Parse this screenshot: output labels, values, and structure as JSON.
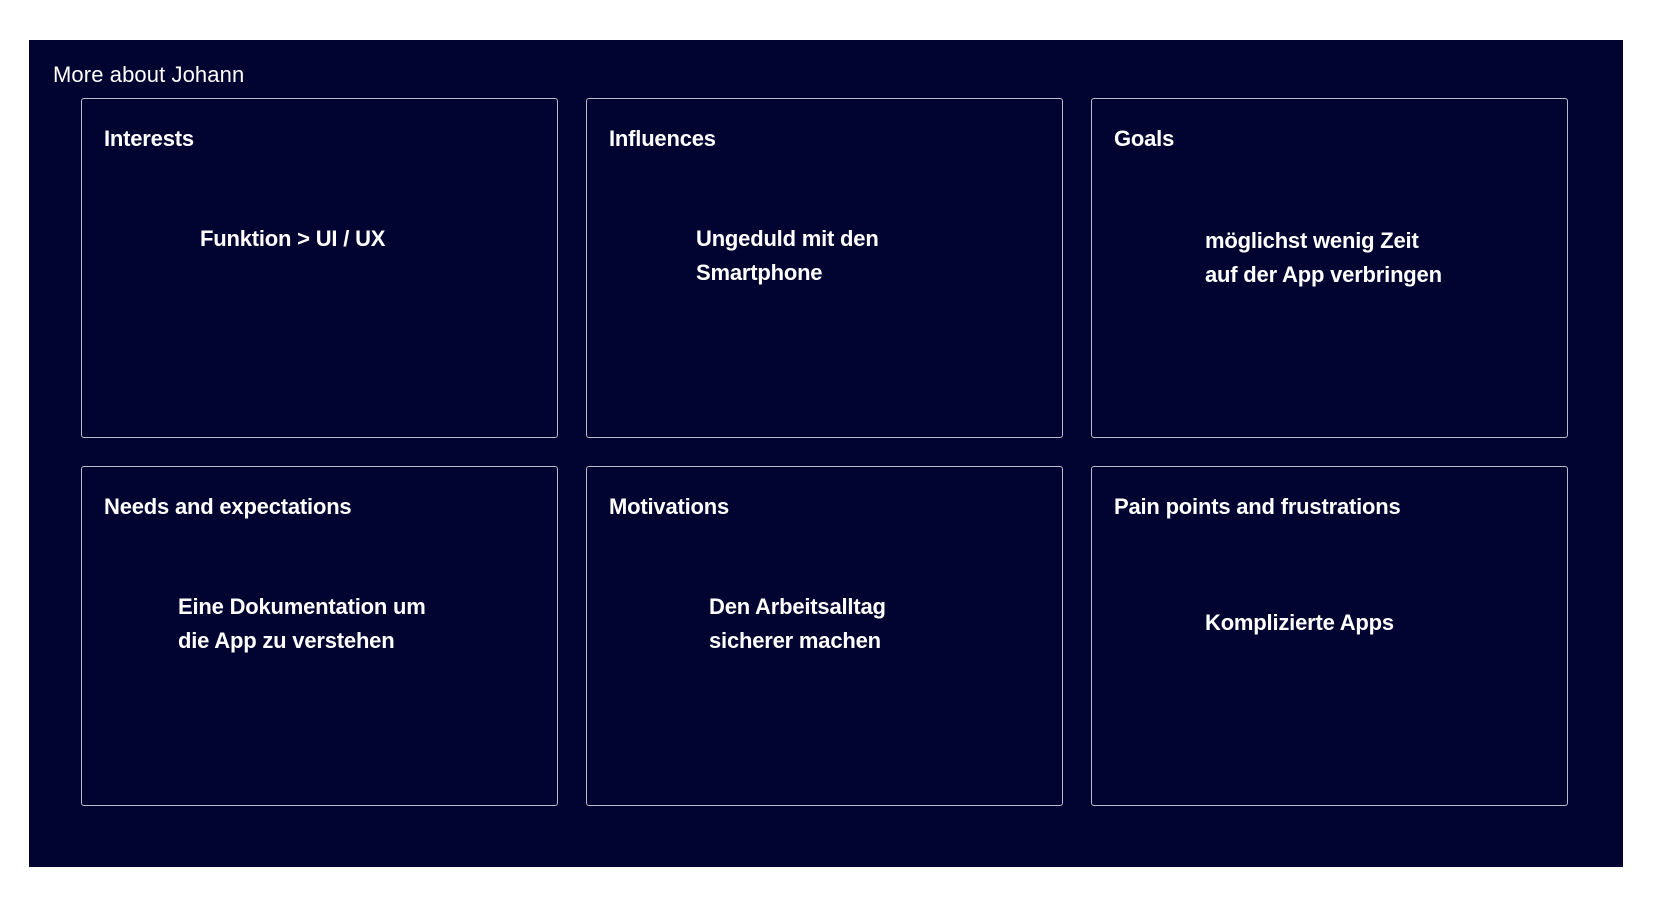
{
  "section": {
    "title": "More about Johann"
  },
  "cards": [
    {
      "heading": "Interests",
      "lines": [
        "Funktion > UI / UX"
      ]
    },
    {
      "heading": "Influences",
      "lines": [
        "Ungeduld mit den",
        "Smartphone"
      ]
    },
    {
      "heading": "Goals",
      "lines": [
        "möglichst wenig Zeit",
        "auf der App verbringen"
      ]
    },
    {
      "heading": "Needs and expectations",
      "lines": [
        "Eine Dokumentation um",
        "die App zu verstehen"
      ]
    },
    {
      "heading": "Motivations",
      "lines": [
        "Den Arbeitsalltag",
        "sicherer machen"
      ]
    },
    {
      "heading": "Pain points and frustrations",
      "lines": [
        "Komplizierte Apps"
      ]
    }
  ],
  "colors": {
    "background": "#010430",
    "card_border": "#b8bbcc",
    "text": "#ffffff"
  }
}
